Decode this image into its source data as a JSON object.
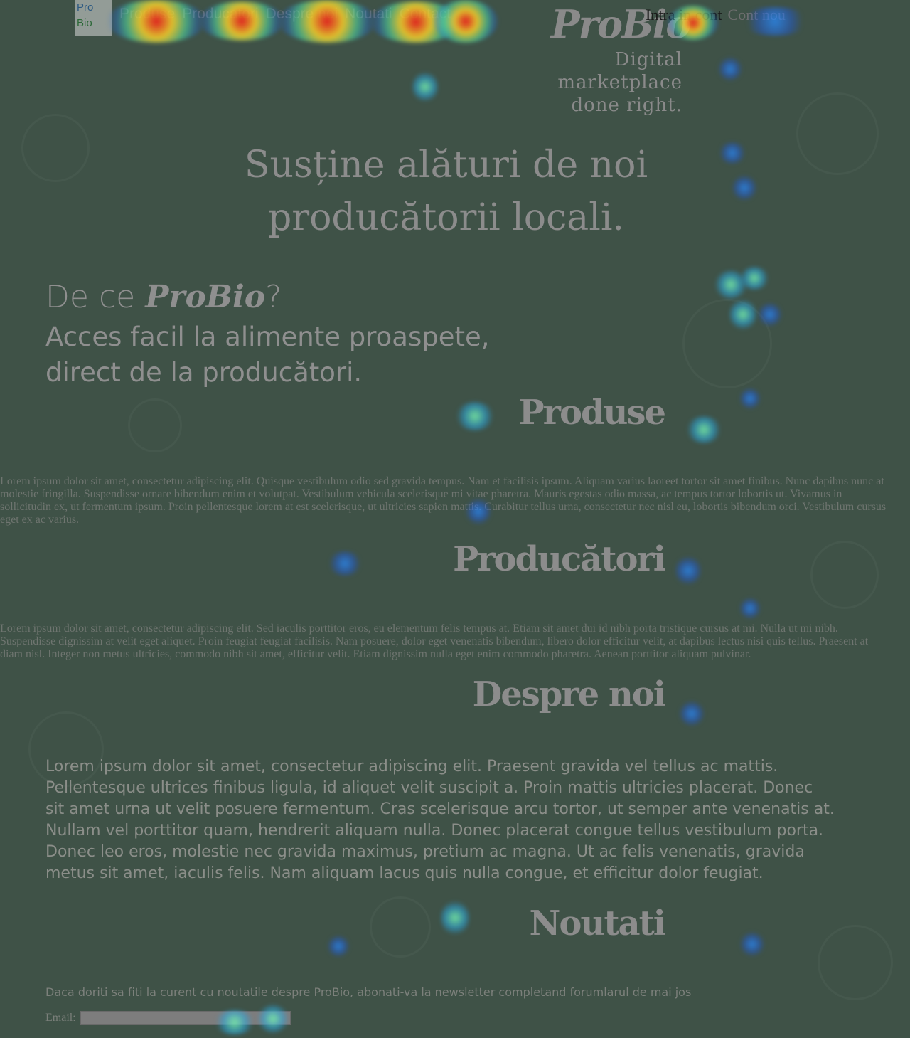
{
  "header": {
    "logo": {
      "line1": "Pro",
      "line2": "Bio"
    },
    "nav": [
      "Produse",
      "Producatori",
      "Despre noi",
      "Noutati",
      "Contact"
    ],
    "brand": "ProBio",
    "tagline_line1": "Digital marketplace",
    "tagline_line2": "done right.",
    "account": {
      "login": "Intra in cont",
      "register": "Cont nou"
    }
  },
  "hero": {
    "line1": "Susține alături de noi",
    "line2": "producătorii locali."
  },
  "why": {
    "prefix": "De ce ",
    "brand": "ProBio",
    "suffix": "?",
    "line1": "Acces facil la alimente proaspete,",
    "line2": "direct de la producători."
  },
  "sections": {
    "produse": {
      "title": "Produse",
      "text": "Lorem ipsum dolor sit amet, consectetur adipiscing elit. Quisque vestibulum odio sed gravida tempus. Nam et facilisis ipsum. Aliquam varius laoreet tortor sit amet finibus. Nunc dapibus nunc at molestie fringilla. Suspendisse ornare bibendum enim et volutpat. Vestibulum vehicula scelerisque mi vitae pharetra. Mauris egestas odio massa, ac tempus tortor lobortis ut. Vivamus in sollicitudin ex, ut fermentum ipsum. Proin pellentesque lorem at est scelerisque, ut ultricies sapien mattis. Curabitur tellus urna, consectetur nec nisl eu, lobortis bibendum orci. Vestibulum cursus eget ex ac varius."
    },
    "producatori": {
      "title": "Producători",
      "text": "Lorem ipsum dolor sit amet, consectetur adipiscing elit. Sed iaculis porttitor eros, eu elementum felis tempus at. Etiam sit amet dui id nibh porta tristique cursus at mi. Nulla ut mi nibh. Suspendisse dignissim at velit eget aliquet. Proin feugiat feugiat facilisis. Nam posuere, dolor eget venenatis bibendum, libero dolor efficitur velit, at dapibus lectus nisi quis tellus. Praesent at diam nisl. Integer non metus ultricies, commodo nibh sit amet, efficitur velit. Etiam dignissim nulla eget enim commodo pharetra. Aenean porttitor aliquam pulvinar."
    },
    "despre": {
      "title": "Despre noi",
      "text": "Lorem ipsum dolor sit amet, consectetur adipiscing elit. Praesent gravida vel tellus ac mattis. Pellentesque ultrices finibus ligula, id aliquet velit suscipit a. Proin mattis ultricies placerat. Donec sit amet urna ut velit posuere fermentum. Cras scelerisque arcu tortor, ut semper ante venenatis at. Nullam vel porttitor quam, hendrerit aliquam nulla. Donec placerat congue tellus vestibulum porta. Donec leo eros, molestie nec gravida maximus, pretium ac magna. Ut ac felis venenatis, gravida metus sit amet, iaculis felis. Nam aliquam lacus quis nulla congue, et efficitur dolor feugiat."
    },
    "noutati": {
      "title": "Noutati",
      "text": "Daca doriti sa fiti la curent cu noutatile despre ProBio, abonati-va la newsletter completand forumlarul de mai jos",
      "email_label": "Email:",
      "email_value": ""
    }
  },
  "colors": {
    "background": "#3f5247",
    "heading": "#8c8c8c"
  }
}
